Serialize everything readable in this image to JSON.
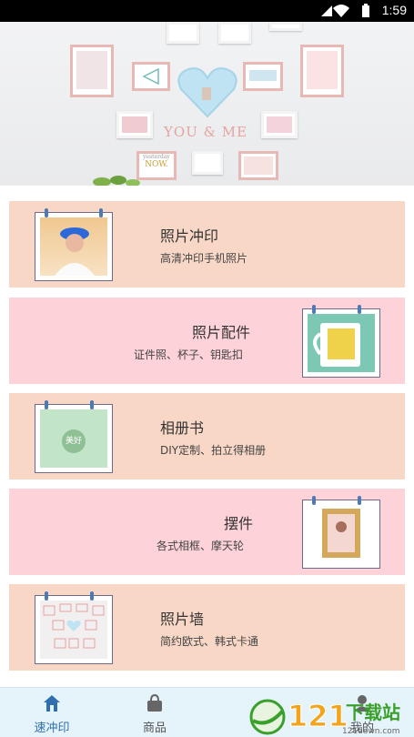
{
  "status_bar": {
    "time": "1:59"
  },
  "banner": {
    "text": "YOU & ME",
    "small_text_1": "yesterday",
    "small_text_2": "NOW."
  },
  "cards": [
    {
      "title": "照片冲印",
      "subtitle": "高清冲印手机照片"
    },
    {
      "title": "照片配件",
      "subtitle": "证件照、杯子、钥匙扣"
    },
    {
      "title": "相册书",
      "subtitle": "DIY定制、拍立得相册"
    },
    {
      "title": "摆件",
      "subtitle": "各式相框、摩天轮"
    },
    {
      "title": "照片墙",
      "subtitle": "简约欧式、韩式卡通"
    }
  ],
  "album_cover_text": "美好",
  "nav": {
    "items": [
      {
        "label": "速冲印",
        "icon": "home-icon",
        "active": true
      },
      {
        "label": "商品",
        "icon": "bag-icon",
        "active": false
      },
      {
        "label": "我的",
        "icon": "user-icon",
        "active": false
      }
    ],
    "active_color": "#2f6fb0",
    "inactive_color": "#555555"
  },
  "watermark": {
    "number": "121",
    "text": "下载站",
    "url": "121down.com"
  }
}
